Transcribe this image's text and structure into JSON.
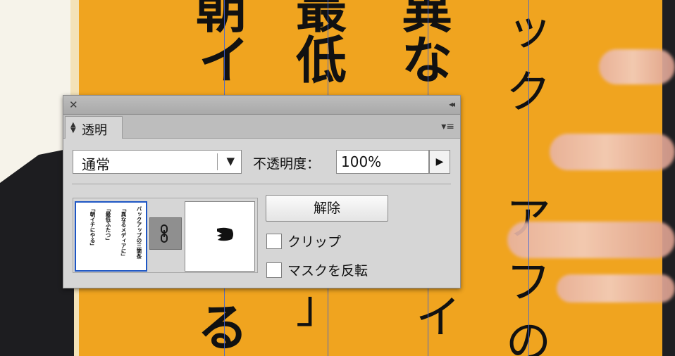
{
  "panel": {
    "close_glyph": "✕",
    "collapse_glyph": "◂◂",
    "tab_label": "透明",
    "tab_menu_glyph": "▾≡",
    "blend_mode": "通常",
    "dropdown_arrow": "▼",
    "opacity_label": "不透明度：",
    "opacity_value": "100%",
    "opacity_step": "▶",
    "release_label": "解除",
    "clip_label": "クリップ",
    "invert_label": "マスクを反転",
    "clip_checked": false,
    "invert_checked": false
  },
  "thumbnail_text": {
    "col1": "バックアップの三箇条",
    "col2": "「異なるメディアに」",
    "col3": "「最低ふたつ」",
    "col4": "「朝イチにやる」"
  },
  "background_glyphs": [
    "朝",
    "イ",
    "最",
    "低",
    "異",
    "な",
    "ッ",
    "ク",
    "ア",
    "フ",
    "の",
    "る",
    "イ",
    "」"
  ],
  "colors": {
    "orange": "#f0a41f",
    "selection_blue": "#1e56c4",
    "guide_blue": "#3d63d8"
  }
}
